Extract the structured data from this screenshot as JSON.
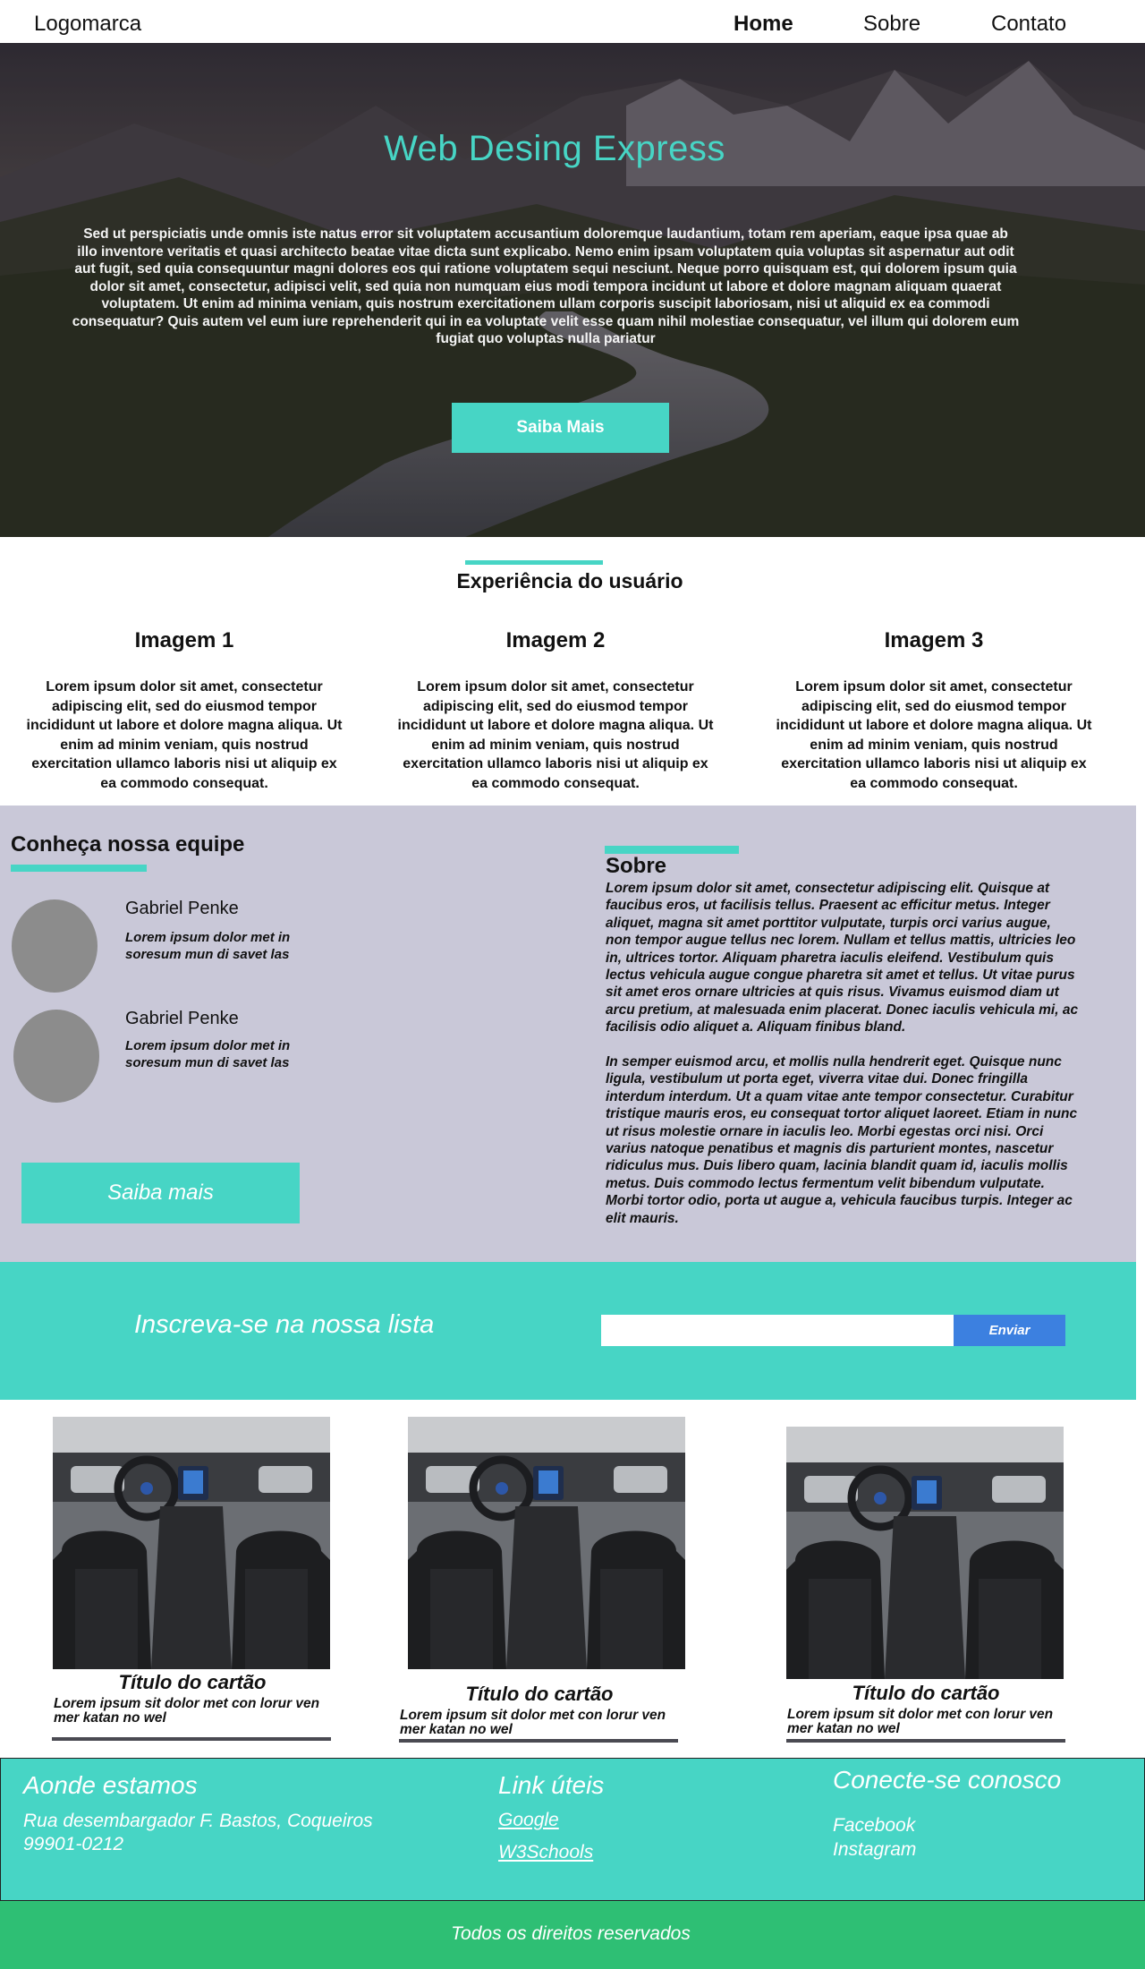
{
  "header": {
    "logo": "Logomarca",
    "nav": [
      "Home",
      "Sobre",
      "Contato"
    ]
  },
  "hero": {
    "title": "Web Desing Express",
    "text": "Sed ut perspiciatis unde omnis iste natus error sit voluptatem accusantium doloremque laudantium, totam rem aperiam, eaque ipsa quae ab illo inventore veritatis et quasi architecto beatae vitae dicta sunt explicabo. Nemo enim ipsam voluptatem quia voluptas sit aspernatur aut odit aut fugit, sed quia consequuntur magni dolores eos qui ratione voluptatem sequi nesciunt. Neque porro quisquam est, qui dolorem ipsum quia dolor sit amet, consectetur, adipisci velit, sed quia non numquam eius modi tempora incidunt ut labore et dolore magnam aliquam quaerat voluptatem. Ut enim ad minima veniam, quis nostrum exercitationem ullam corporis suscipit laboriosam, nisi ut aliquid ex ea commodi consequatur? Quis autem vel eum iure reprehenderit qui in ea voluptate velit esse quam nihil molestiae consequatur, vel illum qui dolorem eum fugiat quo voluptas nulla pariatur",
    "button": "Saiba Mais"
  },
  "experience": {
    "title": "Experiência do usuário",
    "columns": [
      {
        "title": "Imagem 1",
        "text": "Lorem ipsum dolor sit amet, consectetur adipiscing elit, sed do eiusmod tempor incididunt ut labore et dolore magna aliqua. Ut enim ad minim veniam, quis nostrud exercitation ullamco laboris nisi ut aliquip ex ea commodo consequat."
      },
      {
        "title": "Imagem 2",
        "text": "Lorem ipsum dolor sit amet, consectetur adipiscing elit, sed do eiusmod tempor incididunt ut labore et dolore magna aliqua. Ut enim ad minim veniam, quis nostrud exercitation ullamco laboris nisi ut aliquip ex ea commodo consequat."
      },
      {
        "title": "Imagem 3",
        "text": "Lorem ipsum dolor sit amet, consectetur adipiscing elit, sed do eiusmod tempor incididunt ut labore et dolore magna aliqua. Ut enim ad minim veniam, quis nostrud exercitation ullamco laboris nisi ut aliquip ex ea commodo consequat."
      }
    ]
  },
  "team": {
    "title": "Conheça nossa equipe",
    "members": [
      {
        "name": "Gabriel Penke",
        "desc": "Lorem ipsum dolor met in soresum mun di savet las"
      },
      {
        "name": "Gabriel Penke",
        "desc": "Lorem ipsum dolor met in soresum mun di savet las"
      }
    ],
    "button": "Saiba mais"
  },
  "about": {
    "title": "Sobre",
    "paragraphs": [
      "Lorem ipsum dolor sit amet, consectetur adipiscing elit. Quisque at faucibus eros, ut facilisis tellus. Praesent ac efficitur metus. Integer aliquet, magna sit amet porttitor vulputate, turpis orci varius augue, non tempor augue tellus nec lorem. Nullam et tellus mattis, ultricies leo in, ultrices tortor. Aliquam pharetra iaculis eleifend. Vestibulum quis lectus vehicula augue congue pharetra sit amet et tellus. Ut vitae purus sit amet eros ornare ultricies at quis risus. Vivamus euismod diam ut arcu pretium, at malesuada enim placerat. Donec iaculis vehicula mi, ac facilisis odio aliquet a. Aliquam finibus bland.",
      "In semper euismod arcu, et mollis nulla hendrerit eget. Quisque nunc ligula, vestibulum ut porta eget, viverra vitae dui. Donec fringilla interdum interdum. Ut a quam vitae ante tempor consectetur. Curabitur tristique mauris eros, eu consequat tortor aliquet laoreet. Etiam in nunc ut risus molestie ornare in iaculis leo. Morbi egestas orci nisi. Orci varius natoque penatibus et magnis dis parturient montes, nascetur ridiculus mus. Duis libero quam, lacinia blandit quam id, iaculis mollis metus. Duis commodo lectus fermentum velit bibendum vulputate. Morbi tortor odio, porta ut augue a, vehicula faucibus turpis. Integer ac elit mauris."
    ]
  },
  "newsletter": {
    "title": "Inscreva-se na nossa lista",
    "input_value": "",
    "button": "Enviar"
  },
  "cards": [
    {
      "title": "Título do cartão",
      "text": "Lorem ipsum sit dolor met con lorur ven mer katan no wel"
    },
    {
      "title": "Título do cartão",
      "text": "Lorem ipsum sit dolor met con lorur ven mer katan no wel"
    },
    {
      "title": "Título do cartão",
      "text": "Lorem ipsum sit dolor met con lorur ven mer katan no wel"
    }
  ],
  "footer": {
    "location_title": "Aonde estamos",
    "address_line1": "Rua desembargador F. Bastos, Coqueiros",
    "address_line2": "99901-0212",
    "links_title": "Link úteis",
    "links": [
      "Google",
      "W3Schools"
    ],
    "social_title": "Conecte-se conosco",
    "social": [
      "Facebook",
      "Instagram"
    ],
    "copyright": "Todos os direitos reservados"
  },
  "colors": {
    "accent": "#47d5c5",
    "team_bg": "#c9c8d8",
    "send_button": "#3c80e0",
    "copyright_bg": "#2ebf74"
  }
}
